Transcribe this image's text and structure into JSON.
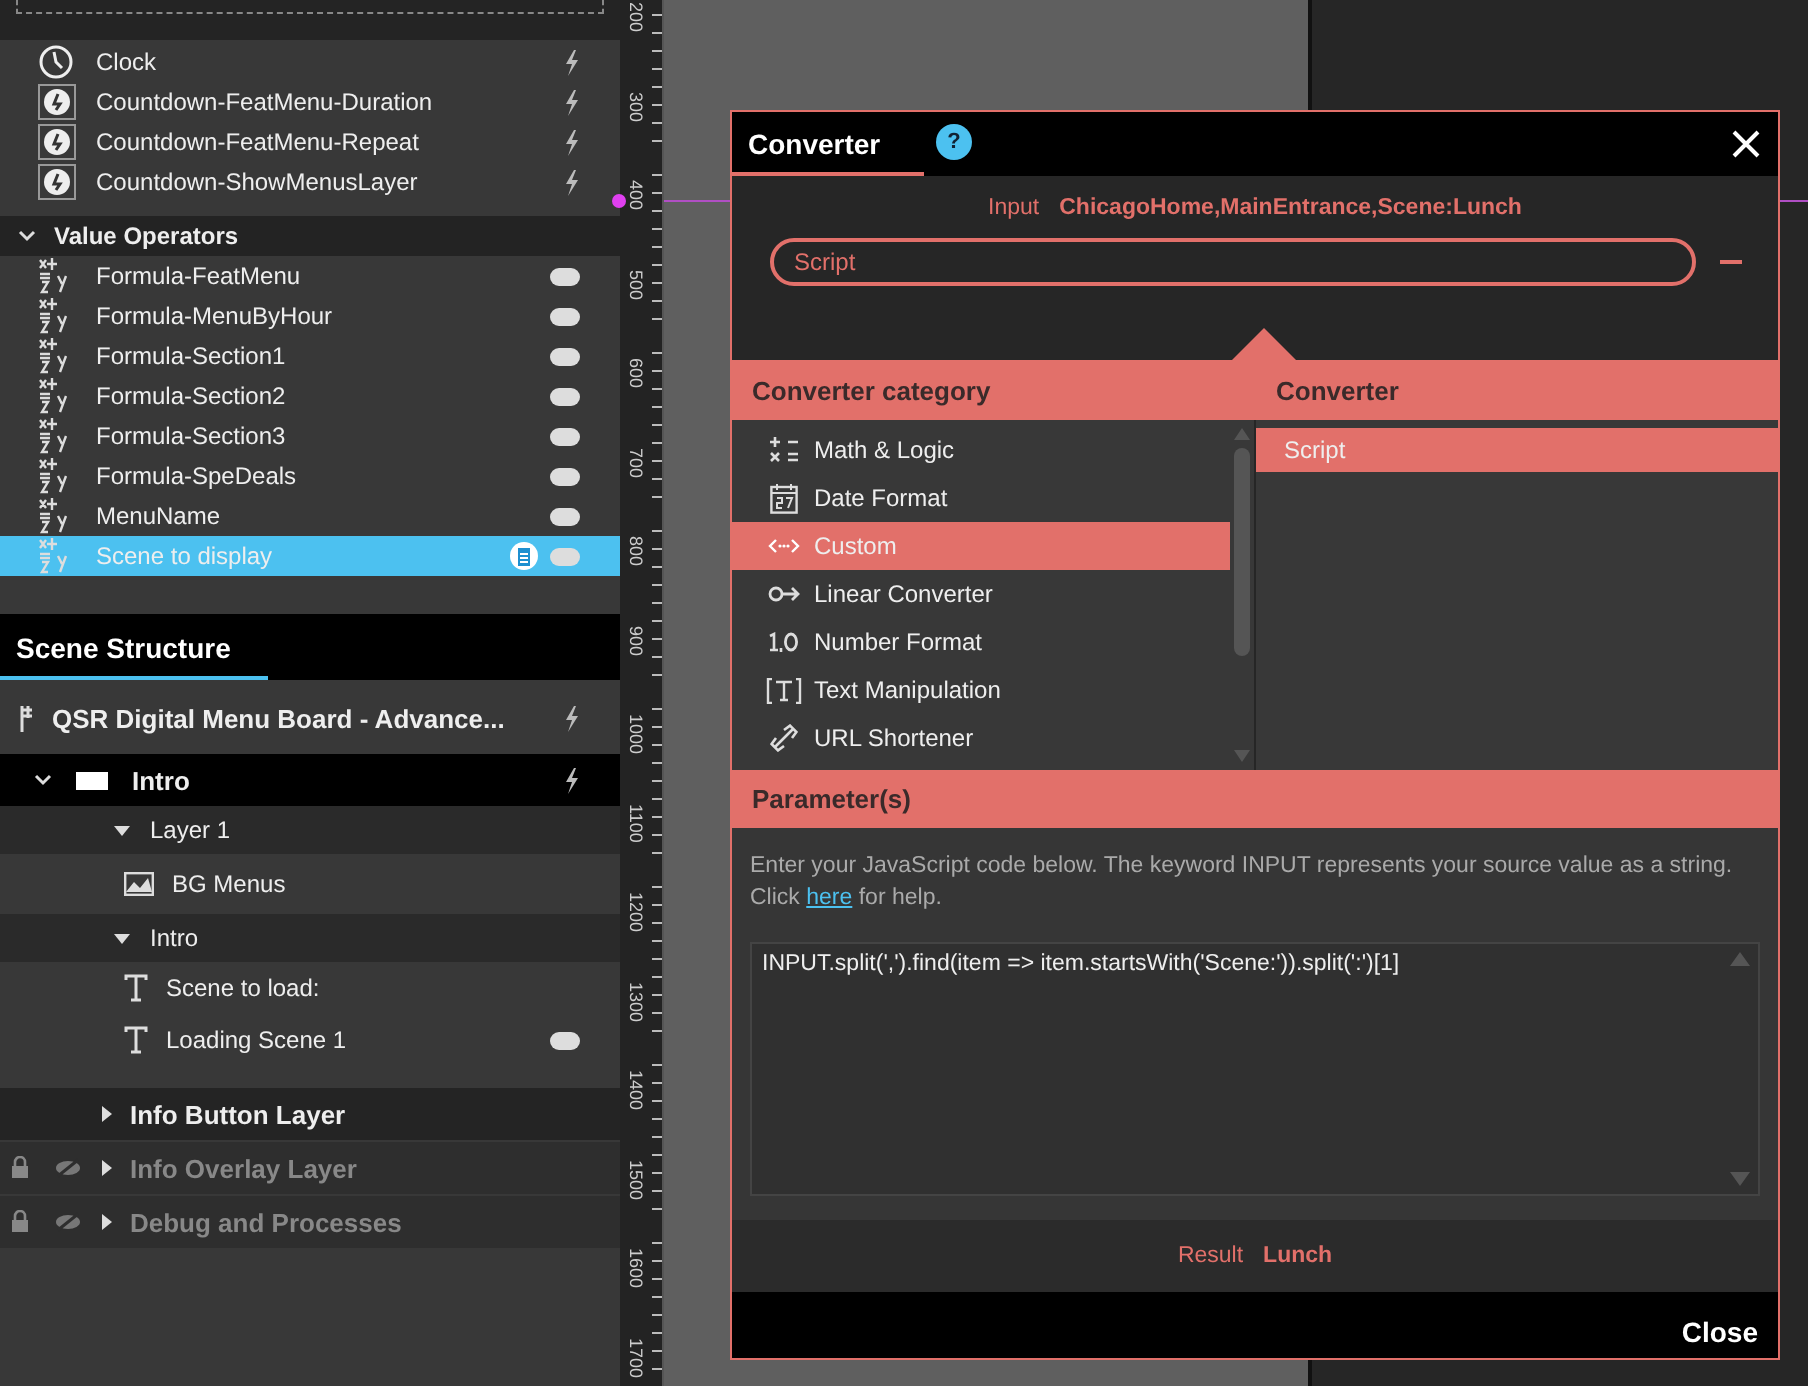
{
  "variables": {
    "time_items": [
      {
        "label": "Clock",
        "kind": "clock",
        "trigger": true
      },
      {
        "label": "Countdown-FeatMenu-Duration",
        "kind": "countdown",
        "trigger": true
      },
      {
        "label": "Countdown-FeatMenu-Repeat",
        "kind": "countdown",
        "trigger": true
      },
      {
        "label": "Countdown-ShowMenusLayer",
        "kind": "countdown",
        "trigger": true
      }
    ],
    "operators": {
      "title": "Value Operators",
      "expanded": true,
      "items": [
        {
          "label": "Formula-FeatMenu",
          "selected": false,
          "linked": false
        },
        {
          "label": "Formula-MenuByHour",
          "selected": false,
          "linked": false
        },
        {
          "label": "Formula-Section1",
          "selected": false,
          "linked": false
        },
        {
          "label": "Formula-Section2",
          "selected": false,
          "linked": false
        },
        {
          "label": "Formula-Section3",
          "selected": false,
          "linked": false
        },
        {
          "label": "Formula-SpeDeals",
          "selected": false,
          "linked": false
        },
        {
          "label": "MenuName",
          "selected": false,
          "linked": false
        },
        {
          "label": "Scene to display",
          "selected": true,
          "linked": true
        }
      ]
    }
  },
  "scene_structure": {
    "tab": {
      "label": "Scene Structure",
      "selected": true
    },
    "project": {
      "label": "QSR Digital Menu Board - Advance..."
    },
    "scene": {
      "label": "Intro",
      "expanded": true,
      "children": [
        {
          "label": "Layer 1",
          "expanded": true,
          "children": [
            {
              "label": "BG Menus",
              "kind": "image",
              "toggle": false
            }
          ]
        },
        {
          "label": "Intro",
          "expanded": true,
          "children": [
            {
              "label": "Scene to load:",
              "kind": "text",
              "toggle": false
            },
            {
              "label": "Loading Scene 1",
              "kind": "text",
              "toggle": true
            }
          ]
        }
      ]
    },
    "layers": [
      {
        "label": "Info Button Layer",
        "locked": false,
        "hidden": false
      },
      {
        "label": "Info Overlay Layer",
        "locked": true,
        "hidden": true
      },
      {
        "label": "Debug and Processes",
        "locked": true,
        "hidden": true
      }
    ]
  },
  "ruler": {
    "labels": [
      "200",
      "300",
      "400",
      "500",
      "600",
      "700",
      "800",
      "900",
      "1000",
      "1100",
      "1200",
      "1300",
      "1400",
      "1500",
      "1600",
      "1700"
    ]
  },
  "converter_dialog": {
    "title": "Converter",
    "help": "?",
    "input_label": "Input",
    "input_value": "ChicagoHome,MainEntrance,Scene:Lunch",
    "converter_field": "Script",
    "category_header": "Converter category",
    "converter_header": "Converter",
    "categories": [
      {
        "label": "Math & Logic",
        "kind": "math",
        "selected": false
      },
      {
        "label": "Date Format",
        "kind": "date",
        "selected": false
      },
      {
        "label": "Custom",
        "kind": "custom",
        "selected": true
      },
      {
        "label": "Linear Converter",
        "kind": "linear",
        "selected": false
      },
      {
        "label": "Number Format",
        "kind": "number",
        "selected": false
      },
      {
        "label": "Text Manipulation",
        "kind": "text",
        "selected": false
      },
      {
        "label": "URL Shortener",
        "kind": "url",
        "selected": false
      }
    ],
    "converters": [
      {
        "label": "Script",
        "selected": true
      }
    ],
    "parameters_header": "Parameter(s)",
    "description": "Enter your JavaScript code below. The keyword INPUT represents your source value as a string. Click ",
    "help_link": "here",
    "description_end": " for help.",
    "code": "INPUT.split(',').find(item => item.startsWith('Scene:')).split(':')[1]",
    "result_label": "Result",
    "result_value": "Lunch",
    "close_button": "Close"
  }
}
